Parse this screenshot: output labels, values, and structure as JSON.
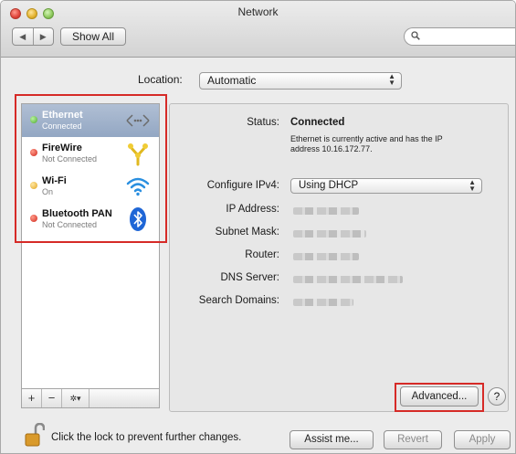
{
  "window": {
    "title": "Network"
  },
  "toolbar": {
    "back_icon": "chevron-left-icon",
    "forward_icon": "chevron-right-icon",
    "show_all_label": "Show All",
    "search_placeholder": ""
  },
  "location": {
    "label": "Location:",
    "value": "Automatic"
  },
  "services": [
    {
      "name": "Ethernet",
      "status": "Connected",
      "status_color": "#4caa2e",
      "icon": "ethernet-icon",
      "selected": true
    },
    {
      "name": "FireWire",
      "status": "Not Connected",
      "status_color": "#d0261c",
      "icon": "firewire-icon",
      "selected": false
    },
    {
      "name": "Wi-Fi",
      "status": "On",
      "status_color": "#e2a41d",
      "icon": "wifi-icon",
      "selected": false
    },
    {
      "name": "Bluetooth PAN",
      "status": "Not Connected",
      "status_color": "#d0261c",
      "icon": "bluetooth-icon",
      "selected": false
    }
  ],
  "sidebar_controls": {
    "add": "+",
    "remove": "−",
    "gear": "✲▾"
  },
  "detail": {
    "status_label": "Status:",
    "status_value": "Connected",
    "status_note": "Ethernet is currently active and has the IP address 10.16.172.77.",
    "configure_label": "Configure IPv4:",
    "configure_value": "Using DHCP",
    "ip_label": "IP Address:",
    "subnet_label": "Subnet Mask:",
    "router_label": "Router:",
    "dns_label": "DNS Server:",
    "search_domains_label": "Search Domains:"
  },
  "buttons": {
    "advanced": "Advanced...",
    "help": "?",
    "assist": "Assist me...",
    "revert": "Revert",
    "apply": "Apply"
  },
  "lock": {
    "text": "Click the lock to prevent further changes."
  },
  "highlight_color": "#d62a27"
}
